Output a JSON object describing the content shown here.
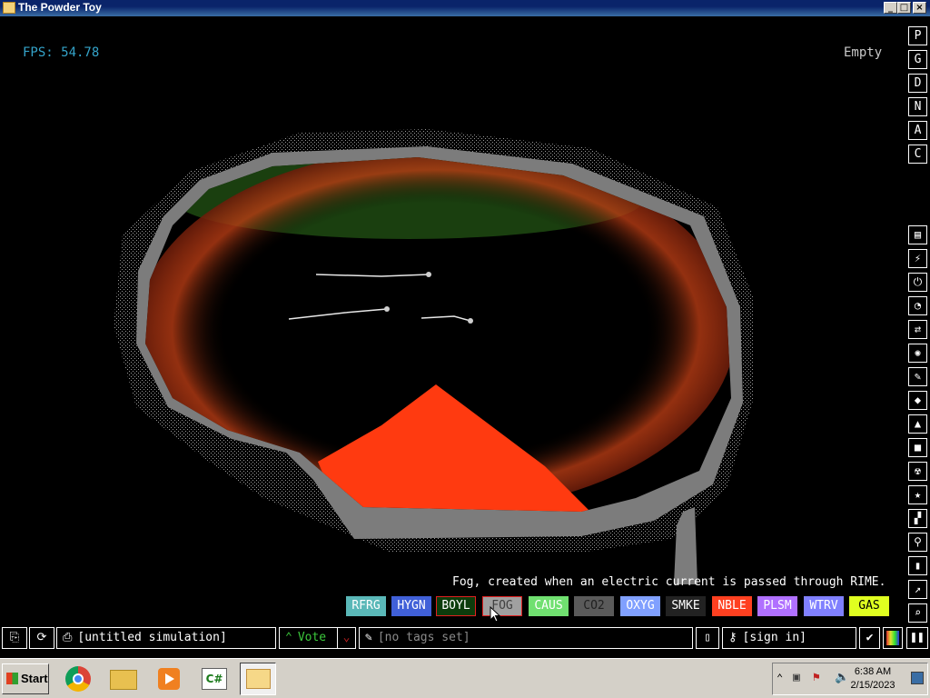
{
  "window": {
    "title": "The Powder Toy"
  },
  "hud": {
    "fps": "FPS: 54.78",
    "status": "Empty"
  },
  "tooltip": "Fog, created when an electric current is passed through RIME.",
  "menu_letters": [
    "P",
    "G",
    "D",
    "N",
    "A",
    "C"
  ],
  "element_buttons": [
    {
      "label": "RFRG",
      "bg": "#5ab8b8",
      "fg": "#ffffff",
      "selected": false
    },
    {
      "label": "HYGN",
      "bg": "#4060d8",
      "fg": "#ffffff",
      "selected": false
    },
    {
      "label": "BOYL",
      "bg": "#0c3c0c",
      "fg": "#ffffff",
      "selected": true
    },
    {
      "label": "FOG",
      "bg": "#a0a0a0",
      "fg": "#404040",
      "selected": true
    },
    {
      "label": "CAUS",
      "bg": "#70e070",
      "fg": "#ffffff",
      "selected": false
    },
    {
      "label": "CO2",
      "bg": "#5a5a5a",
      "fg": "#202020",
      "selected": false
    },
    {
      "label": "OXYG",
      "bg": "#80a0ff",
      "fg": "#ffffff",
      "selected": false
    },
    {
      "label": "SMKE",
      "bg": "#222222",
      "fg": "#ffffff",
      "selected": false
    },
    {
      "label": "NBLE",
      "bg": "#ff4020",
      "fg": "#ffffff",
      "selected": false
    },
    {
      "label": "PLSM",
      "bg": "#b070ff",
      "fg": "#ffffff",
      "selected": false
    },
    {
      "label": "WTRV",
      "bg": "#8080ff",
      "fg": "#ffffff",
      "selected": false
    },
    {
      "label": "GAS",
      "bg": "#e0ff20",
      "fg": "#000000",
      "selected": false
    }
  ],
  "bottom_bar": {
    "sim_name": "[untitled simulation]",
    "vote": "Vote",
    "tags": "[no tags set]",
    "sign_in": "[sign in]"
  },
  "taskbar": {
    "start": "Start",
    "time": "6:38 AM",
    "date": "2/15/2023"
  },
  "colors": {
    "accent_green": "#3cc83c",
    "fps": "#34a3c9",
    "selection": "#e02020"
  }
}
